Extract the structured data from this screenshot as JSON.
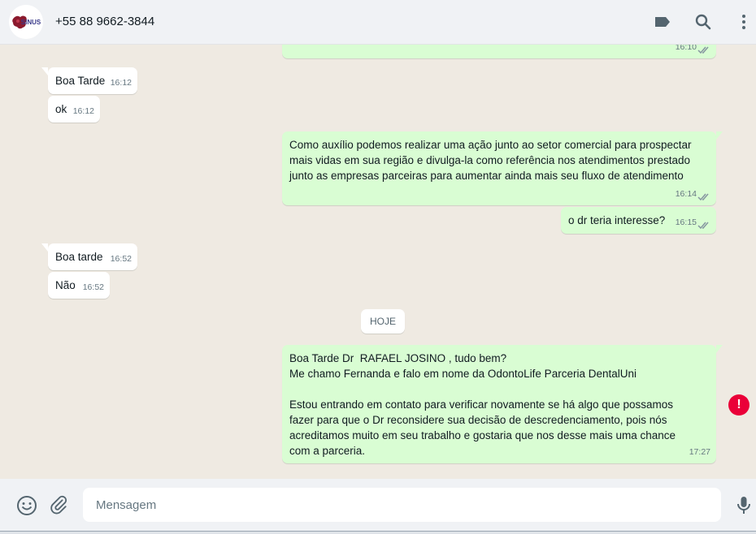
{
  "header": {
    "contact_name": "+55 88 9662-3844",
    "avatar_text": "SINUS",
    "icons": [
      "label-icon",
      "search-icon",
      "menu-icon"
    ]
  },
  "messages": {
    "m0": {
      "direction": "out",
      "time": "16:10",
      "status": "read"
    },
    "m1": {
      "direction": "in",
      "text": "Boa Tarde",
      "time": "16:12"
    },
    "m2": {
      "direction": "in",
      "text": "ok",
      "time": "16:12"
    },
    "m3": {
      "direction": "out",
      "text": "Como auxílio podemos realizar uma ação junto ao setor comercial para prospectar\nmais vidas em sua região e divulga-la como referência nos atendimentos prestado\njunto as empresas parceiras para aumentar ainda mais seu fluxo de atendimento",
      "time": "16:14",
      "status": "read"
    },
    "m4": {
      "direction": "out",
      "text": "o dr teria interesse?",
      "time": "16:15",
      "status": "read"
    },
    "m5": {
      "direction": "in",
      "text": "Boa tarde",
      "time": "16:52"
    },
    "m6": {
      "direction": "in",
      "text": "Não",
      "time": "16:52"
    },
    "m7": {
      "direction": "out",
      "text": "Boa Tarde Dr  RAFAEL JOSINO , tudo bem?\nMe chamo Fernanda e falo em nome da OdontoLife Parceria DentalUni\n\nEstou entrando em contato para verificar novamente se há algo que possamos\nfazer para que o Dr reconsidere sua decisão de descredenciamento, pois nós\nacreditamos muito em seu trabalho e gostaria que nos desse mais uma chance\ncom a parceria.",
      "time": "17:27",
      "status": "failed"
    }
  },
  "date_divider": "HOJE",
  "composer": {
    "placeholder": "Mensagem",
    "icons": [
      "emoji-icon",
      "attach-icon",
      "mic-icon"
    ]
  },
  "colors": {
    "outgoing_bubble": "#d9fdd3",
    "incoming_bubble": "#ffffff",
    "chat_background": "#efeae2",
    "header_background": "#f0f2f5",
    "read_ticks": "#8696a0",
    "error": "#ea0038"
  }
}
